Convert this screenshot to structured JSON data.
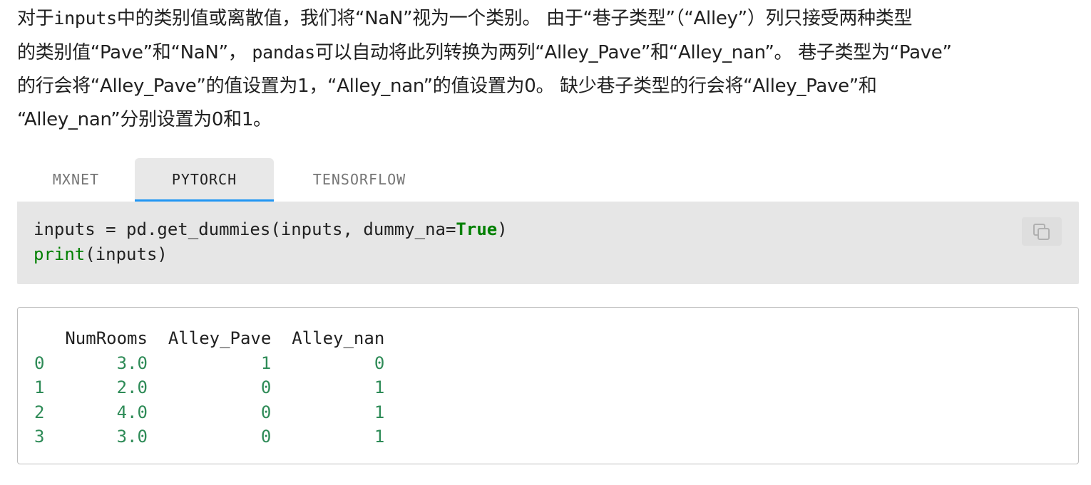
{
  "paragraph": {
    "line1_a": "对于",
    "line1_code": "inputs",
    "line1_b": "中的类别值或离散值，我们将“NaN”视为一个类别。 由于“巷子类型”（“Alley”）列只接受两种类型",
    "line2_a": "的类别值“Pave”和“NaN”，",
    "line2_code": "pandas",
    "line2_b": "可以自动将此列转换为两列“Alley_Pave”和“Alley_nan”。 巷子类型为“Pave”",
    "line3": "的行会将“Alley_Pave”的值设置为1，“Alley_nan”的值设置为0。 缺少巷子类型的行会将“Alley_Pave”和",
    "line4": "“Alley_nan”分别设置为0和1。"
  },
  "tabs": [
    {
      "label": "MXNET",
      "active": false
    },
    {
      "label": "PYTORCH",
      "active": true
    },
    {
      "label": "TENSORFLOW",
      "active": false
    }
  ],
  "code": {
    "line1_pre": "inputs = pd.get_dummies(inputs, dummy_na=",
    "line1_kw": "True",
    "line1_post": ")",
    "line2_fn": "print",
    "line2_rest": "(inputs)"
  },
  "copy_button": {
    "icon": "copy-icon"
  },
  "output": {
    "header": "   NumRooms  Alley_Pave  Alley_nan",
    "rows": [
      {
        "idx": "0",
        "numrooms": "3.0",
        "pave": "1",
        "nan": "0"
      },
      {
        "idx": "1",
        "numrooms": "2.0",
        "pave": "0",
        "nan": "1"
      },
      {
        "idx": "2",
        "numrooms": "4.0",
        "pave": "0",
        "nan": "1"
      },
      {
        "idx": "3",
        "numrooms": "3.0",
        "pave": "0",
        "nan": "1"
      }
    ]
  },
  "colors": {
    "accent": "#2196f3",
    "keyword": "#008000",
    "number": "#2e8b57"
  }
}
